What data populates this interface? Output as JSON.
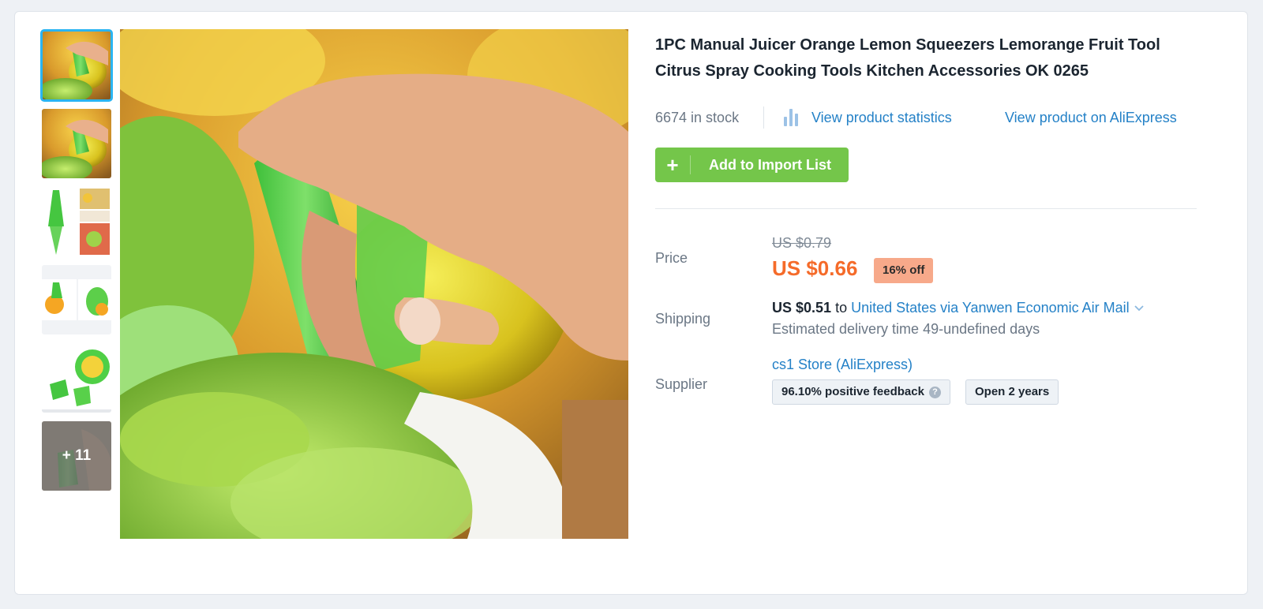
{
  "product": {
    "title": "1PC Manual Juicer Orange Lemon Squeezers Lemorange Fruit Tool Citrus Spray Cooking Tools Kitchen Accessories OK 0265",
    "stock": "6674 in stock",
    "view_statistics": "View product statistics",
    "view_on_aliexpress": "View product on AliExpress",
    "add_button": "Add to Import List",
    "add_button_icon": "+"
  },
  "gallery": {
    "more_count": "+ 11"
  },
  "price": {
    "label": "Price",
    "original": "US $0.79",
    "current": "US $0.66",
    "discount": "16% off"
  },
  "shipping": {
    "label": "Shipping",
    "price": "US $0.51",
    "to": "to",
    "method": "United States via Yanwen Economic Air Mail",
    "delivery": "Estimated delivery time 49-undefined days"
  },
  "supplier": {
    "label": "Supplier",
    "store": "cs1 Store (AliExpress)",
    "feedback": "96.10% positive feedback",
    "help_icon": "?",
    "open": "Open 2 years"
  },
  "colors": {
    "accent_blue": "#2481c7",
    "button_green": "#74c64a",
    "price_orange": "#f56b2a",
    "discount_bg": "#f7a98a",
    "thumb_active": "#2ab4f2"
  },
  "icons": [
    "bar-chart-icon",
    "plus-icon",
    "chevron-down-icon",
    "question-icon"
  ]
}
